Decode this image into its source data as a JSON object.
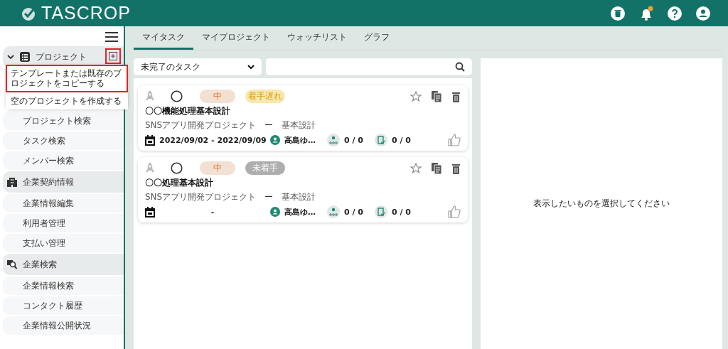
{
  "header": {
    "logo": "TASCROP",
    "notification_badge": true
  },
  "sidebar": {
    "groups": [
      {
        "kind": "project",
        "label": "プロジェクト",
        "expanded": true,
        "add_highlighted": true,
        "menu": [
          {
            "label": "テンプレートまたは既存のプロジェクトをコピーする",
            "highlighted": true
          },
          {
            "label": "空のプロジェクトを作成する",
            "highlighted": false
          }
        ],
        "items": [
          "プロジェクト検索",
          "タスク検索",
          "メンバー検索"
        ]
      },
      {
        "kind": "company",
        "label": "企業契約情報",
        "items": [
          "企業情報編集",
          "利用者管理",
          "支払い管理"
        ]
      },
      {
        "kind": "search",
        "label": "企業検索",
        "items": [
          "企業情報検索",
          "コンタクト履歴",
          "企業情報公開状況"
        ]
      }
    ]
  },
  "tabs": [
    {
      "label": "マイタスク",
      "selected": true
    },
    {
      "label": "マイプロジェクト",
      "selected": false
    },
    {
      "label": "ウォッチリスト",
      "selected": false
    },
    {
      "label": "グラフ",
      "selected": false
    }
  ],
  "filter": {
    "value": "未完了のタスク"
  },
  "tasks": [
    {
      "priority": "中",
      "status": {
        "label": "着手遅れ",
        "kind": "late"
      },
      "title": "〇〇機能処理基本設計",
      "project": "SNSアプリ開発プロジェクト",
      "dash": "ー",
      "phase": "基本設計",
      "dates": "2022/09/02 - 2022/09/09",
      "assignee": "高島ゆ…",
      "subtasks": "0 / 0",
      "checks": "0 / 0"
    },
    {
      "priority": "中",
      "status": {
        "label": "未着手",
        "kind": "todo"
      },
      "title": "〇〇処理基本設計",
      "project": "SNSアプリ開発プロジェクト",
      "dash": "ー",
      "phase": "基本設計",
      "dates": "-",
      "assignee": "高島ゆ…",
      "subtasks": "0 / 0",
      "checks": "0 / 0"
    }
  ],
  "detail": {
    "message": "表示したいものを選択してください"
  }
}
